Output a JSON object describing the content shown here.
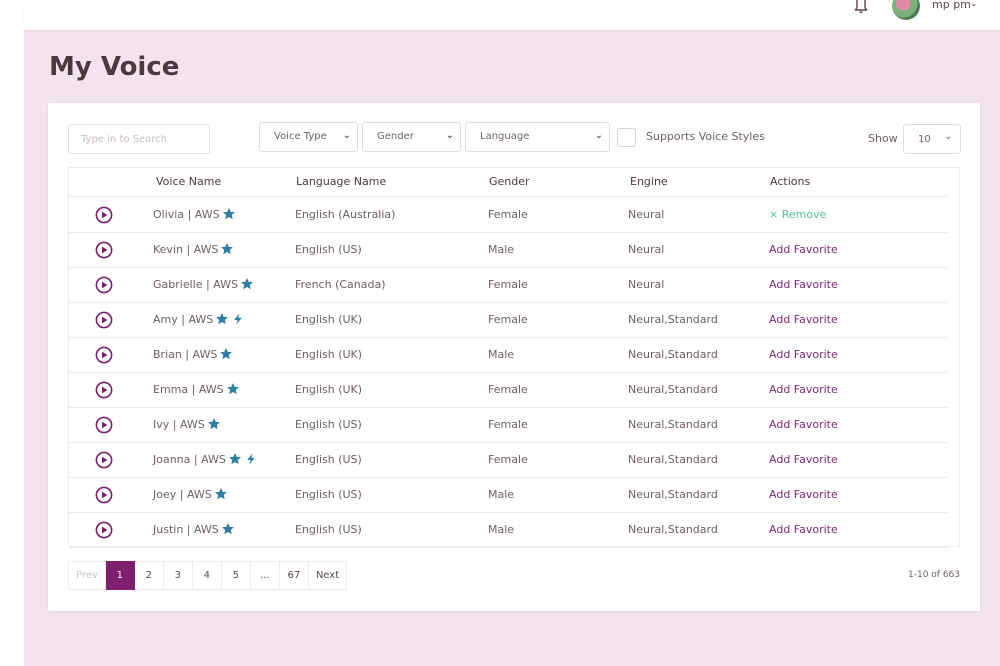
{
  "header": {
    "user_name": "mp pm",
    "user_caret": "⌄"
  },
  "page": {
    "title": "My Voice"
  },
  "filters": {
    "search_placeholder": "Type in to Search",
    "voice_type": "Voice Type",
    "gender": "Gender",
    "language": "Language",
    "supports_styles_label": "Supports Voice Styles",
    "show_label": "Show",
    "show_value": "10"
  },
  "table": {
    "headers": [
      "Voice Name",
      "Language Name",
      "Gender",
      "Engine",
      "Actions"
    ],
    "rows": [
      {
        "name": "Olivia | AWS",
        "star": true,
        "bolt": false,
        "language": "English (Australia)",
        "gender": "Female",
        "engine": "Neural",
        "action": "× Remove",
        "action_type": "remove"
      },
      {
        "name": "Kevin | AWS",
        "star": true,
        "bolt": false,
        "language": "English (US)",
        "gender": "Male",
        "engine": "Neural",
        "action": "Add Favorite",
        "action_type": "add"
      },
      {
        "name": "Gabrielle | AWS",
        "star": true,
        "bolt": false,
        "language": "French (Canada)",
        "gender": "Female",
        "engine": "Neural",
        "action": "Add Favorite",
        "action_type": "add"
      },
      {
        "name": "Amy | AWS",
        "star": true,
        "bolt": true,
        "language": "English (UK)",
        "gender": "Female",
        "engine": "Neural,Standard",
        "action": "Add Favorite",
        "action_type": "add"
      },
      {
        "name": "Brian | AWS",
        "star": true,
        "bolt": false,
        "language": "English (UK)",
        "gender": "Male",
        "engine": "Neural,Standard",
        "action": "Add Favorite",
        "action_type": "add"
      },
      {
        "name": "Emma | AWS",
        "star": true,
        "bolt": false,
        "language": "English (UK)",
        "gender": "Female",
        "engine": "Neural,Standard",
        "action": "Add Favorite",
        "action_type": "add"
      },
      {
        "name": "Ivy | AWS",
        "star": true,
        "bolt": false,
        "language": "English (US)",
        "gender": "Female",
        "engine": "Neural,Standard",
        "action": "Add Favorite",
        "action_type": "add"
      },
      {
        "name": "Joanna | AWS",
        "star": true,
        "bolt": true,
        "language": "English (US)",
        "gender": "Female",
        "engine": "Neural,Standard",
        "action": "Add Favorite",
        "action_type": "add"
      },
      {
        "name": "Joey | AWS",
        "star": true,
        "bolt": false,
        "language": "English (US)",
        "gender": "Male",
        "engine": "Neural,Standard",
        "action": "Add Favorite",
        "action_type": "add"
      },
      {
        "name": "Justin | AWS",
        "star": true,
        "bolt": false,
        "language": "English (US)",
        "gender": "Male",
        "engine": "Neural,Standard",
        "action": "Add Favorite",
        "action_type": "add"
      }
    ]
  },
  "pagination": {
    "items": [
      "Prev",
      "1",
      "2",
      "3",
      "4",
      "5",
      "...",
      "67",
      "Next"
    ],
    "active": "1",
    "disabled": [
      "Prev"
    ],
    "count_text": "1-10 of 663"
  },
  "colors": {
    "accent": "#7d1f6e",
    "remove": "#4cc399",
    "background": "#f3e3ee",
    "star": "#2a7fa8"
  },
  "icons": {
    "bell": "bell-icon",
    "play": "play-circle-icon",
    "star": "star-icon",
    "bolt": "lightning-icon"
  }
}
